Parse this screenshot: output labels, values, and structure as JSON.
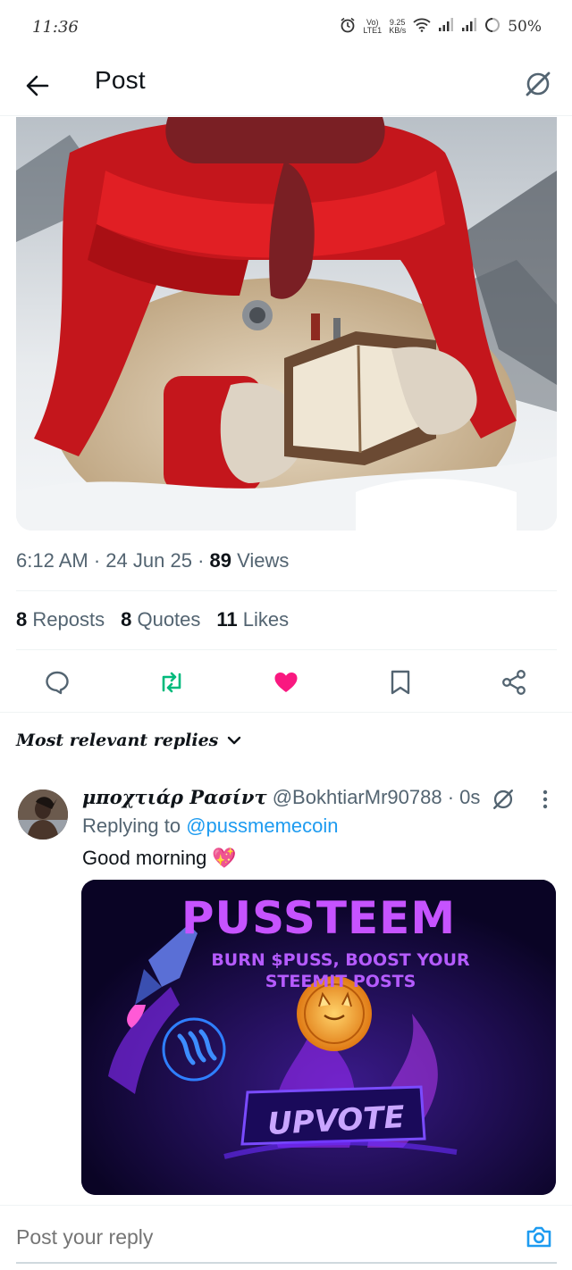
{
  "status_bar": {
    "time": "11:36",
    "network_speed_value": "9.25",
    "network_speed_unit": "KB/s",
    "volte_top": "Vo)",
    "volte_bottom": "LTE1",
    "battery": "50%"
  },
  "header": {
    "title": "Post"
  },
  "post": {
    "time": "6:12 AM",
    "date": "24 Jun 25",
    "views_count": "89",
    "views_label": "Views",
    "reposts_count": "8",
    "reposts_label": "Reposts",
    "quotes_count": "8",
    "quotes_label": "Quotes",
    "likes_count": "11",
    "likes_label": "Likes",
    "liked": true,
    "colors": {
      "like": "#f91880",
      "repost": "#00ba7c",
      "icon": "#536471"
    }
  },
  "replies": {
    "sort_label": "Most relevant replies",
    "items": [
      {
        "display_name": "μποχτιάρ Ρασίντ",
        "handle": "@BokhtiarMr90788",
        "time": "0s",
        "replying_prefix": "Replying to",
        "replying_to": "@pussmemecoin",
        "text": "Good morning",
        "emoji": "💖",
        "media": {
          "title": "PUSSTEEM",
          "subtitle_line1": "BURN $PUSS, BOOST YOUR",
          "subtitle_line2": "STEEMIT POSTS",
          "button": "UPVOTE"
        }
      }
    ]
  },
  "composer": {
    "placeholder": "Post your reply"
  }
}
